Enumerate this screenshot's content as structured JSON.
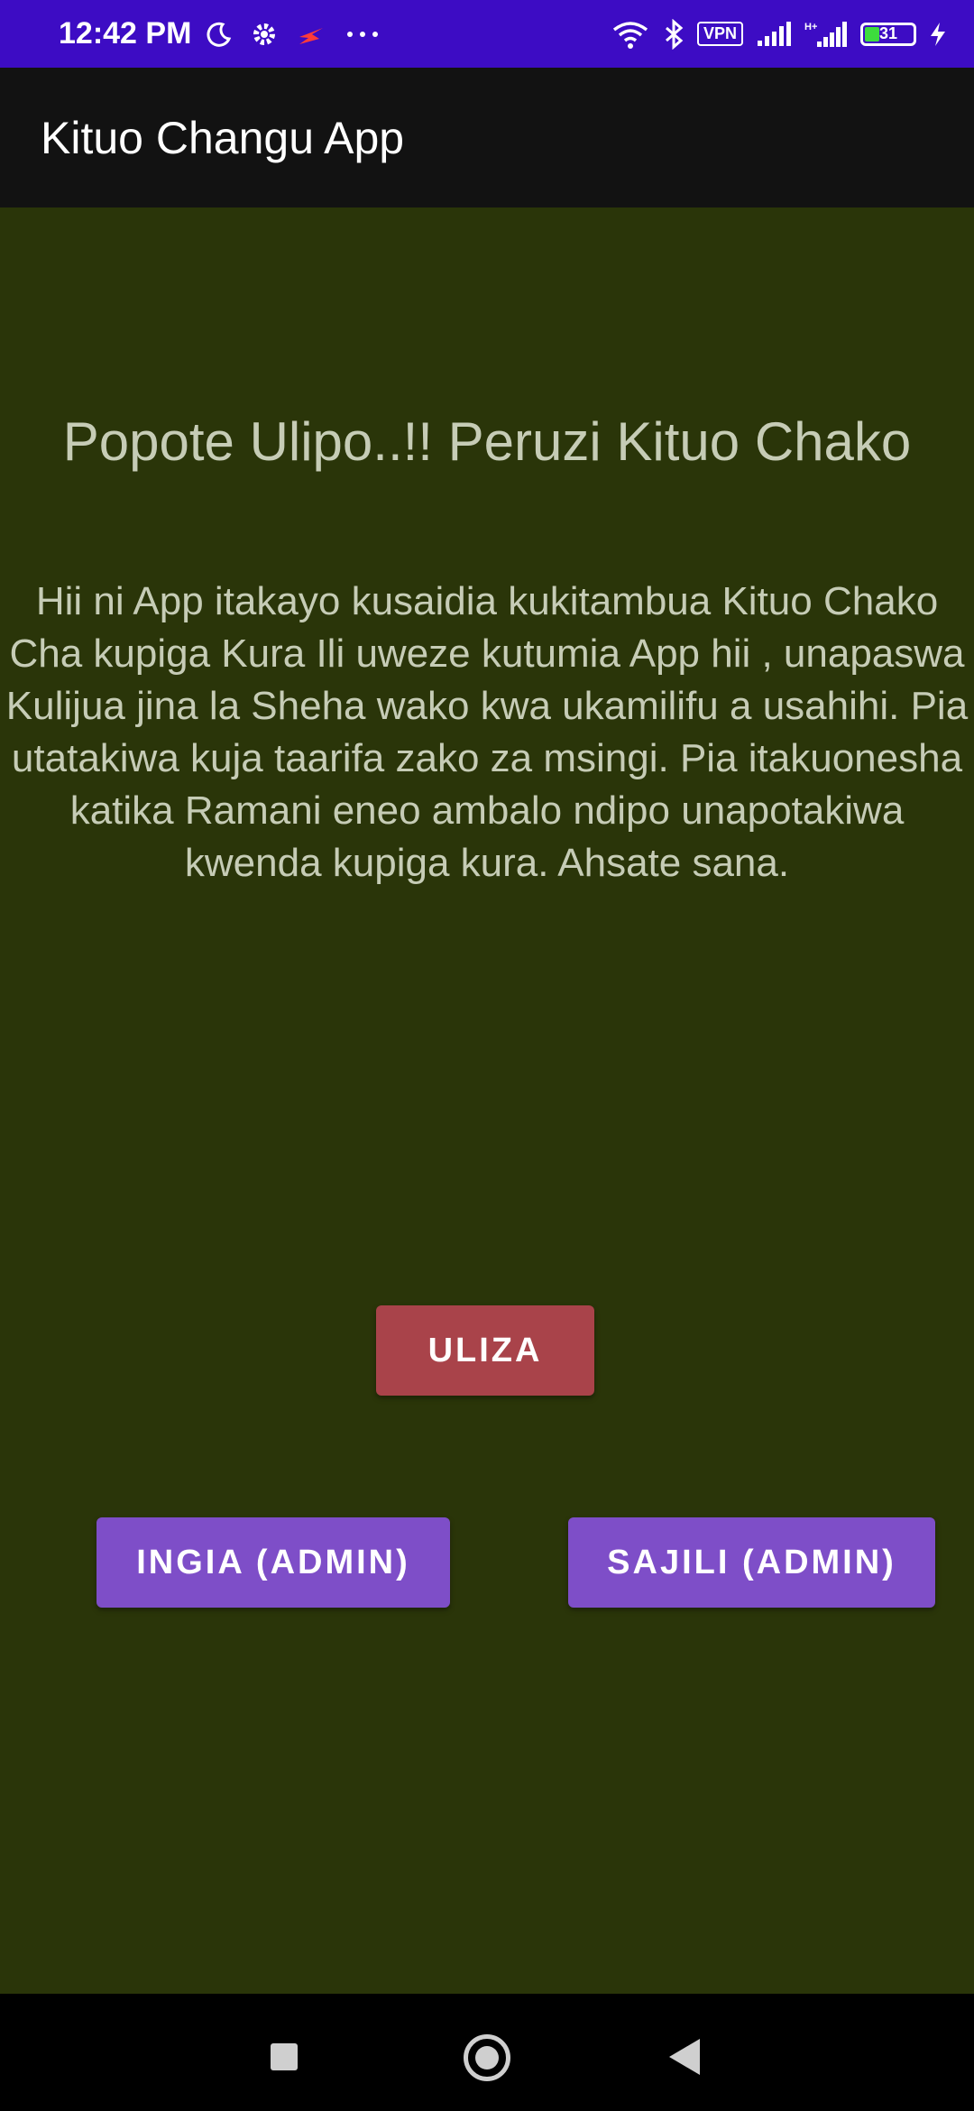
{
  "status_bar": {
    "time": "12:42 PM",
    "vpn": "VPN",
    "battery": "31",
    "icons": [
      "moon-icon",
      "gear-icon",
      "flash-icon",
      "more-dots-icon",
      "wifi-icon",
      "bluetooth-icon",
      "vpn-icon",
      "signal-icon",
      "signal-hplus-icon",
      "battery-icon",
      "charging-icon"
    ]
  },
  "app_bar": {
    "title": "Kituo Changu App"
  },
  "main": {
    "headline": "Popote Ulipo..!! Peruzi Kituo Chako",
    "description": "Hii ni App itakayo kusaidia kukitambua Kituo Chako Cha kupiga Kura Ili uweze kutumia App hii , unapaswa Kulijua jina la Sheha wako kwa ukamilifu a usahihi. Pia utatakiwa kuja taarifa zako za msingi. Pia itakuonesha katika Ramani eneo ambalo ndipo unapotakiwa kwenda kupiga kura. Ahsate sana.",
    "uliza_label": "ULIZA",
    "ingia_label": "INGIA (ADMIN)",
    "sajili_label": "SAJILI (ADMIN)"
  },
  "colors": {
    "status_bar": "#3d0cc4",
    "app_bar": "#121212",
    "background": "#2a3509",
    "uliza_button": "#a9434a",
    "admin_buttons": "#7e4ec8",
    "text": "#c6ccb6"
  }
}
